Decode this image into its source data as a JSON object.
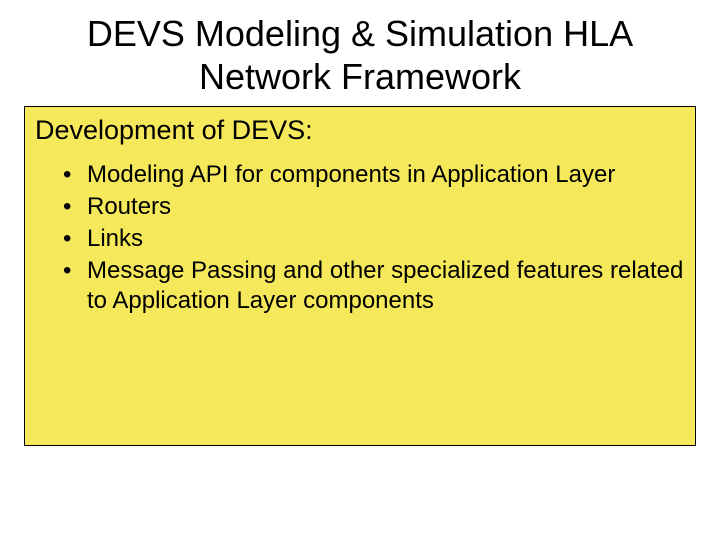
{
  "slide": {
    "title": "DEVS Modeling & Simulation HLA Network Framework",
    "subtitle": "Development of DEVS:",
    "bullets": [
      "Modeling API for components in Application Layer",
      "Routers",
      "Links",
      "Message Passing and other specialized features related to Application Layer components"
    ]
  }
}
